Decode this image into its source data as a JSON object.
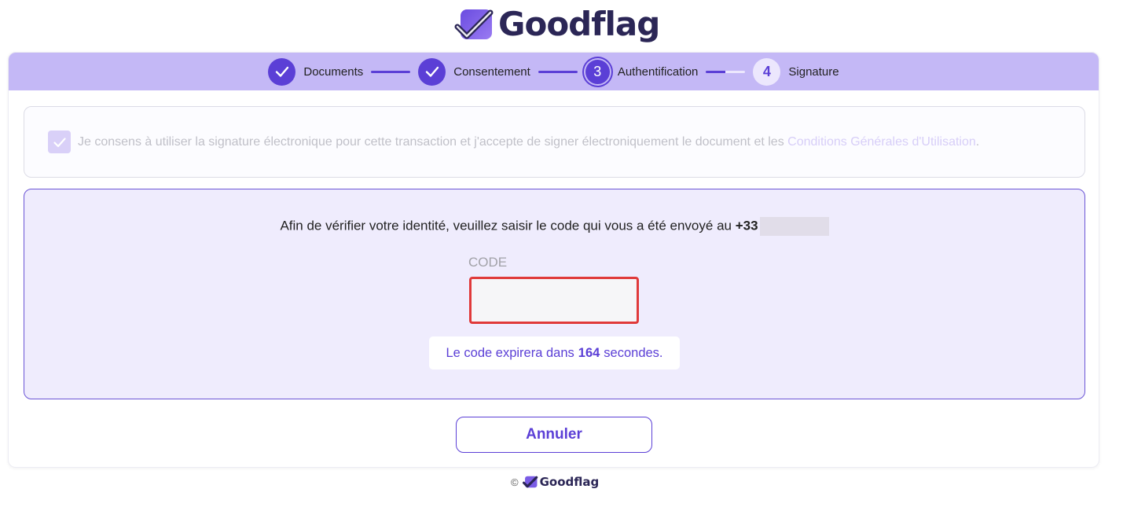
{
  "brand": {
    "name": "Goodflag",
    "colors": {
      "primary": "#5b3fd6",
      "navy": "#2b2656",
      "lavender": "#c4b8f6",
      "error": "#e03a3a"
    }
  },
  "stepper": {
    "steps": [
      {
        "label": "Documents",
        "state": "done",
        "icon": "check-icon"
      },
      {
        "label": "Consentement",
        "state": "done",
        "icon": "check-icon"
      },
      {
        "label": "Authentification",
        "state": "current",
        "number": "3"
      },
      {
        "label": "Signature",
        "state": "upcoming",
        "number": "4"
      }
    ]
  },
  "consent": {
    "checked": true,
    "text": "Je consens à utiliser la signature électronique pour cette transaction et j'accepte de signer électroniquement le document et les",
    "link": "Conditions Générales d'Utilisation",
    "suffix": "."
  },
  "verification": {
    "instruction": "Afin de vérifier votre identité, veuillez saisir le code qui vous a été envoyé au",
    "phone_prefix": "+33",
    "code_label": "CODE",
    "code_value": "",
    "expire_prefix": "Le code expirera dans",
    "expire_seconds": "164",
    "expire_suffix": "secondes."
  },
  "actions": {
    "cancel_label": "Annuler"
  },
  "footer": {
    "copyright": "©",
    "brand": "Goodflag"
  }
}
